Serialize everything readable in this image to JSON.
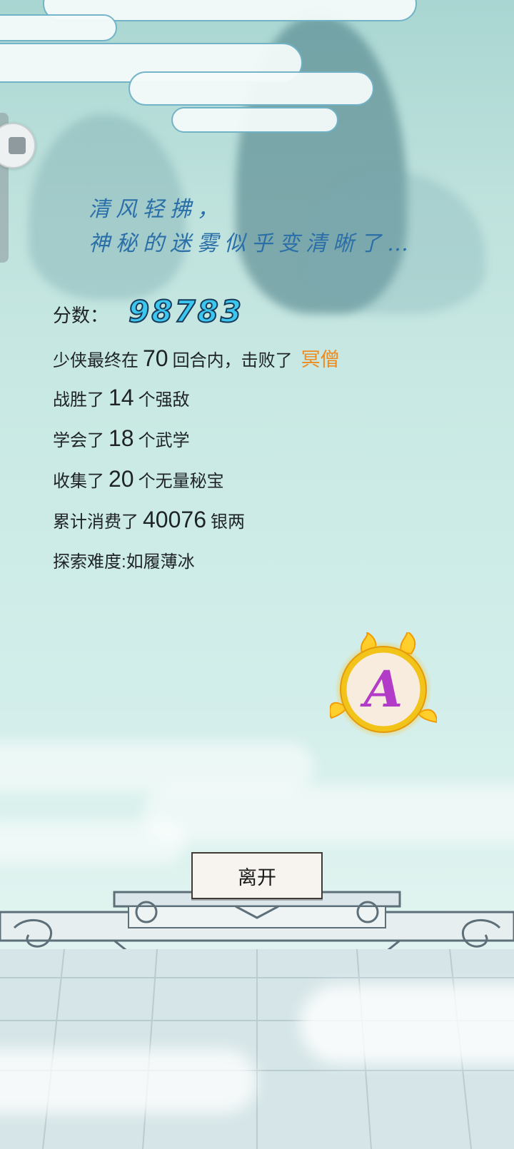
{
  "poem": {
    "line1": "清风轻拂，",
    "line2": "神秘的迷雾似乎变清晰了…"
  },
  "score": {
    "label": "分数：",
    "value": "98783"
  },
  "summary": {
    "turns_prefix": "少侠最终在",
    "turns": "70",
    "turns_suffix": "回合内，击败了",
    "boss_name": "冥僧"
  },
  "stats": [
    {
      "prefix": "战胜了",
      "value": "14",
      "suffix": "个强敌"
    },
    {
      "prefix": "学会了",
      "value": "18",
      "suffix": "个武学"
    },
    {
      "prefix": "收集了",
      "value": "20",
      "suffix": "个无量秘宝"
    },
    {
      "prefix": "累计消费了",
      "value": "40076",
      "suffix": "银两"
    }
  ],
  "difficulty": "探索难度:如履薄冰",
  "rank": {
    "letter": "A",
    "ring_color": "#f2c318",
    "letter_color": "#b23bc8"
  },
  "leave_button": "离开",
  "colors": {
    "score_fill": "#3cc7f0",
    "boss_name": "#f08a1c",
    "poem_text": "#2b6fa8"
  }
}
